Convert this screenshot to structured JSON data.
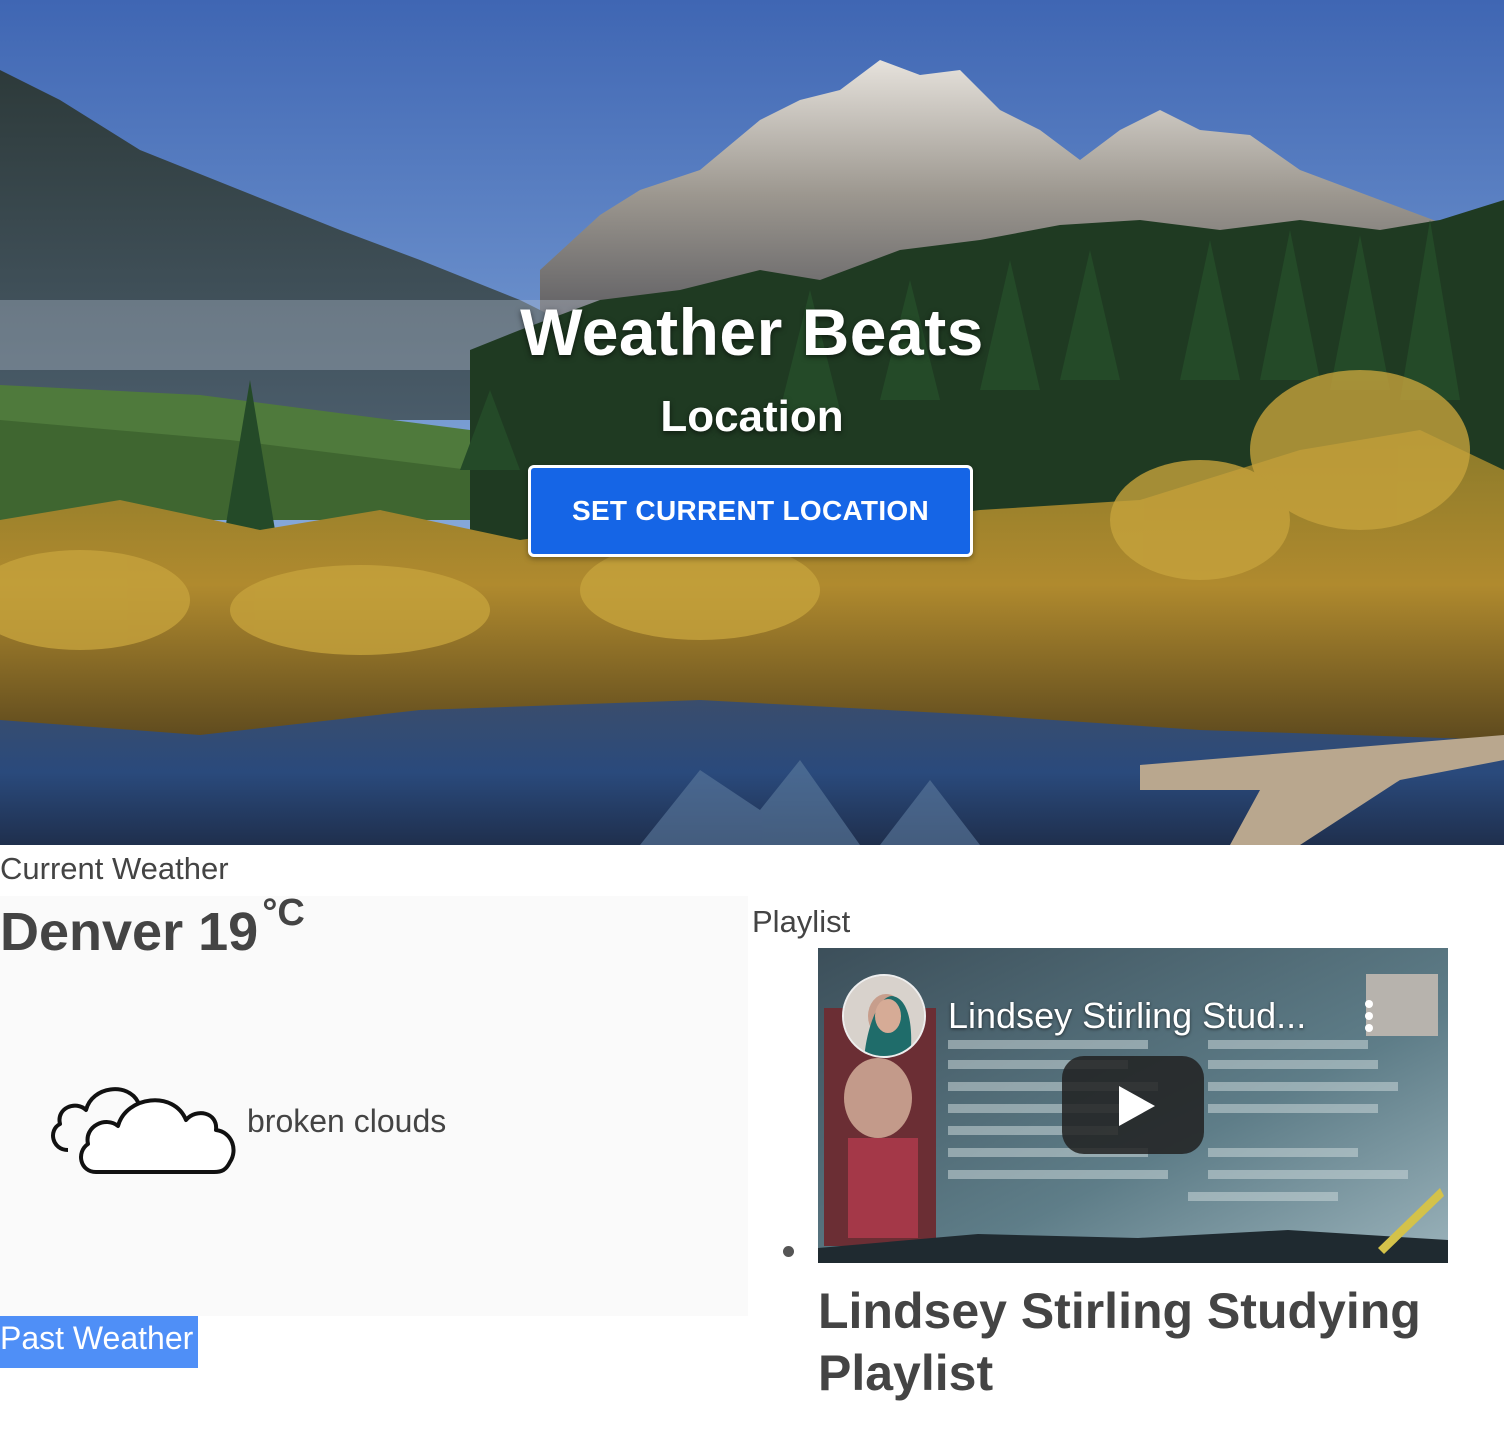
{
  "hero": {
    "title": "Weather Beats",
    "subtitle": "Location",
    "button_label": "SET CURRENT LOCATION"
  },
  "current_weather": {
    "section_label": "Current Weather",
    "city": "Denver",
    "temperature": "19",
    "unit": "°C",
    "icon": "cloud-icon",
    "description": "broken clouds"
  },
  "past_weather": {
    "label": "Past Weather"
  },
  "playlist": {
    "section_label": "Playlist",
    "video": {
      "overlay_title": "Lindsey Stirling Stud...",
      "icons": [
        "avatar",
        "kebab-menu-icon",
        "play-icon"
      ]
    },
    "title": "Lindsey Stirling Studying Playlist"
  },
  "colors": {
    "primary_button": "#1565e6",
    "highlight": "#4f8ff7",
    "text": "#444444"
  }
}
